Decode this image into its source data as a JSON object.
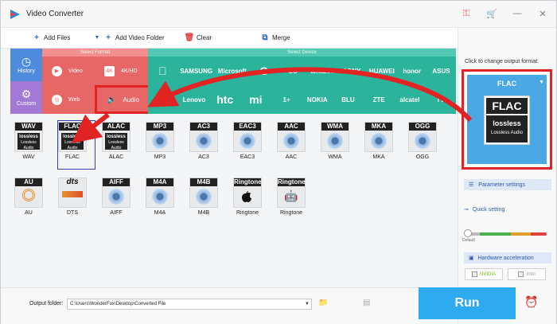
{
  "app": {
    "title": "Video Converter"
  },
  "toolbar": {
    "add_files": "Add Files",
    "add_video_folder": "Add Video Folder",
    "clear": "Clear",
    "merge": "Merge"
  },
  "side": {
    "history": "History",
    "custom": "Custom"
  },
  "select_format": {
    "header": "Select Format",
    "items": [
      "Video",
      "4K/HD",
      "Web",
      "Audio"
    ]
  },
  "select_device": {
    "header": "Select Device",
    "row1": [
      "",
      "SAMSUNG",
      "Microsoft",
      "G",
      "LG",
      "amazon",
      "SONY",
      "HUAWEI",
      "honor",
      "ASUS"
    ],
    "row2": [
      "→",
      "Lenovo",
      "htc",
      "mi",
      "1+",
      "NOKIA",
      "BLU",
      "ZTE",
      "alcatel",
      "TV"
    ]
  },
  "formats": {
    "row1": [
      {
        "tag": "WAV",
        "label": "WAV",
        "kind": "lossless"
      },
      {
        "tag": "FLAC",
        "label": "FLAC",
        "kind": "lossless"
      },
      {
        "tag": "ALAC",
        "label": "ALAC",
        "kind": "lossless"
      },
      {
        "tag": "MP3",
        "label": "MP3",
        "kind": "disc"
      },
      {
        "tag": "AC3",
        "label": "AC3",
        "kind": "disc"
      },
      {
        "tag": "EAC3",
        "label": "EAC3",
        "kind": "disc"
      },
      {
        "tag": "AAC",
        "label": "AAC",
        "kind": "disc"
      },
      {
        "tag": "WMA",
        "label": "WMA",
        "kind": "disc"
      },
      {
        "tag": "MKA",
        "label": "MKA",
        "kind": "disc"
      },
      {
        "tag": "OGG",
        "label": "OGG",
        "kind": "disc"
      }
    ],
    "row2": [
      {
        "tag": "AU",
        "label": "AU",
        "kind": "au"
      },
      {
        "tag": "dts",
        "label": "DTS",
        "kind": "dts"
      },
      {
        "tag": "AIFF",
        "label": "AIFF",
        "kind": "disc"
      },
      {
        "tag": "M4A",
        "label": "M4A",
        "kind": "disc"
      },
      {
        "tag": "M4B",
        "label": "M4B",
        "kind": "disc"
      },
      {
        "tag": "Ringtone",
        "label": "Ringtone",
        "kind": "apple"
      },
      {
        "tag": "Ringtone",
        "label": "Ringtone",
        "kind": "android"
      }
    ],
    "lossless_text": "lossless",
    "lossless_sub": "Lossless Audio"
  },
  "right": {
    "hint": "Click to change output format:",
    "format_name": "FLAC",
    "badge_title": "FLAC",
    "badge_logo": "lossless",
    "badge_sub": "Lossless Audio",
    "parameter_settings": "Parameter settings",
    "quick_setting": "Quick setting",
    "default": "Default",
    "hardware_acceleration": "Hardware acceleration",
    "nvidia": "NVIDIA",
    "intel": "Intel"
  },
  "bottom": {
    "output_folder_label": "Output folder:",
    "output_path": "C:\\Users\\WonderFox\\Desktop\\Converted File",
    "run": "Run"
  }
}
